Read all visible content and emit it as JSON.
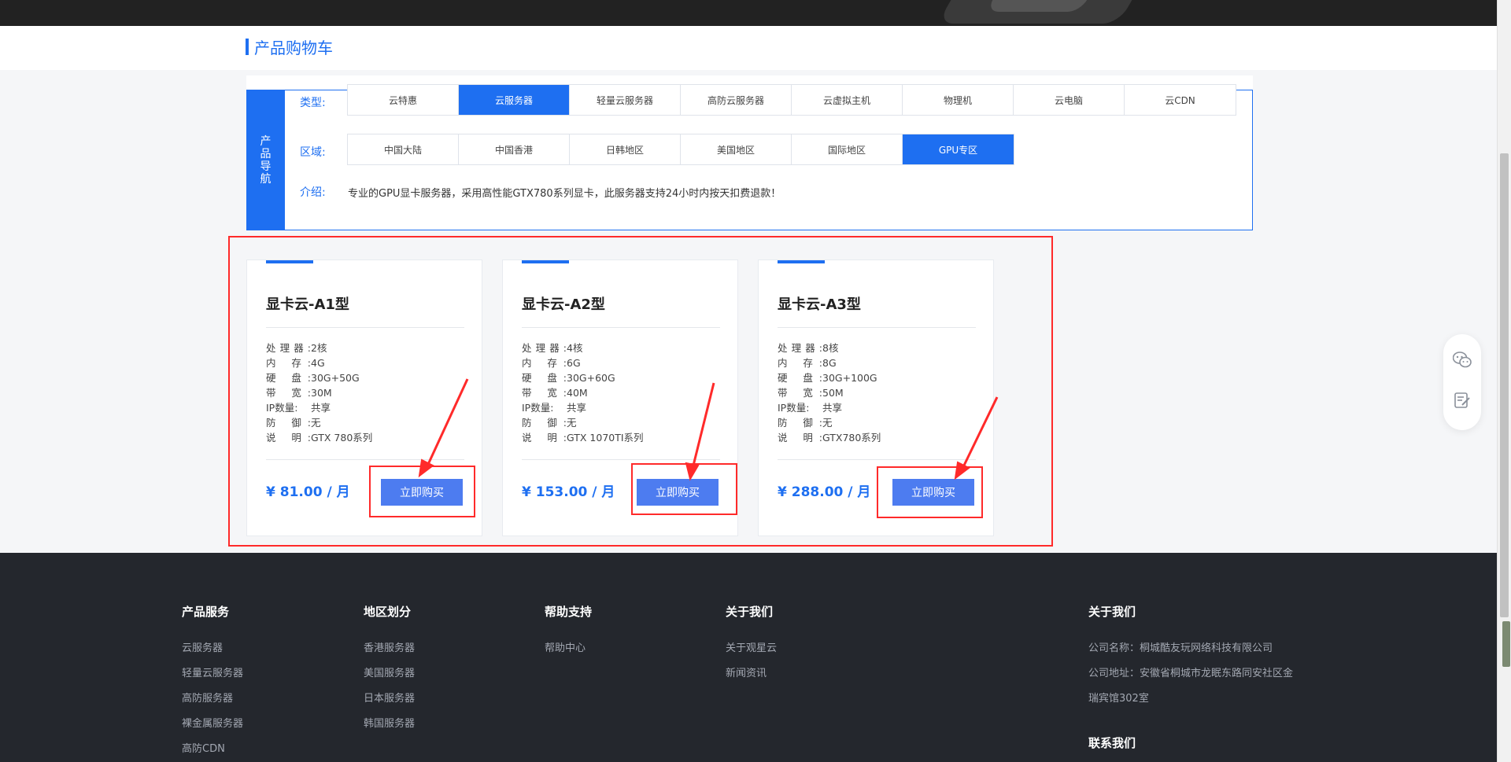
{
  "page": {
    "title": "产品购物车"
  },
  "nav": {
    "side_label": "产品导航",
    "type_label": "类型:",
    "region_label": "区域:",
    "intro_label": "介绍:",
    "types": [
      "云特惠",
      "云服务器",
      "轻量云服务器",
      "高防云服务器",
      "云虚拟主机",
      "物理机",
      "云电脑",
      "云CDN"
    ],
    "active_type": "云服务器",
    "regions": [
      "中国大陆",
      "中国香港",
      "日韩地区",
      "美国地区",
      "国际地区",
      "GPU专区"
    ],
    "active_region": "GPU专区",
    "intro": "专业的GPU显卡服务器，采用高性能GTX780系列显卡，此服务器支持24小时内按天扣费退款！"
  },
  "spec_labels": {
    "cpu": "处理器:",
    "mem": "内 存:",
    "disk": "硬 盘:",
    "bw": "带 宽:",
    "ip": "IP数量:",
    "defense": "防 御:",
    "desc": "说 明:"
  },
  "products": [
    {
      "name": "显卡云-A1型",
      "cpu": "2核",
      "mem": "4G",
      "disk": "30G+50G",
      "bw": "30M",
      "ip": "共享",
      "defense": "无",
      "desc": "GTX 780系列",
      "price": "¥ 81.00 / 月",
      "buy": "立即购买"
    },
    {
      "name": "显卡云-A2型",
      "cpu": "4核",
      "mem": "6G",
      "disk": "30G+60G",
      "bw": "40M",
      "ip": "共享",
      "defense": "无",
      "desc": "GTX 1070TI系列",
      "price": "¥ 153.00 / 月",
      "buy": "立即购买"
    },
    {
      "name": "显卡云-A3型",
      "cpu": "8核",
      "mem": "8G",
      "disk": "30G+100G",
      "bw": "50M",
      "ip": "共享",
      "defense": "无",
      "desc": "GTX780系列",
      "price": "¥ 288.00 / 月",
      "buy": "立即购买"
    }
  ],
  "footer": {
    "col1": {
      "title": "产品服务",
      "links": [
        "云服务器",
        "轻量云服务器",
        "高防服务器",
        "裸金属服务器",
        "高防CDN"
      ]
    },
    "col2": {
      "title": "地区划分",
      "links": [
        "香港服务器",
        "美国服务器",
        "日本服务器",
        "韩国服务器"
      ]
    },
    "col3": {
      "title": "帮助支持",
      "links": [
        "帮助中心"
      ]
    },
    "col4": {
      "title": "关于我们",
      "links": [
        "关于观星云",
        "新闻资讯"
      ]
    },
    "col5": {
      "title": "关于我们",
      "company": "公司名称：桐城酷友玩网络科技有限公司",
      "address1": "公司地址：安徽省桐城市龙眠东路同安社区金",
      "address2": "瑞宾馆302室",
      "contact_title": "联系我们"
    }
  },
  "icons": {
    "wechat": "wechat-icon",
    "feedback": "feedback-icon"
  },
  "colors": {
    "accent": "#1e6ff1",
    "button": "#4d7cf0",
    "highlight": "#ff2a2a",
    "footer_bg": "#24272d"
  }
}
